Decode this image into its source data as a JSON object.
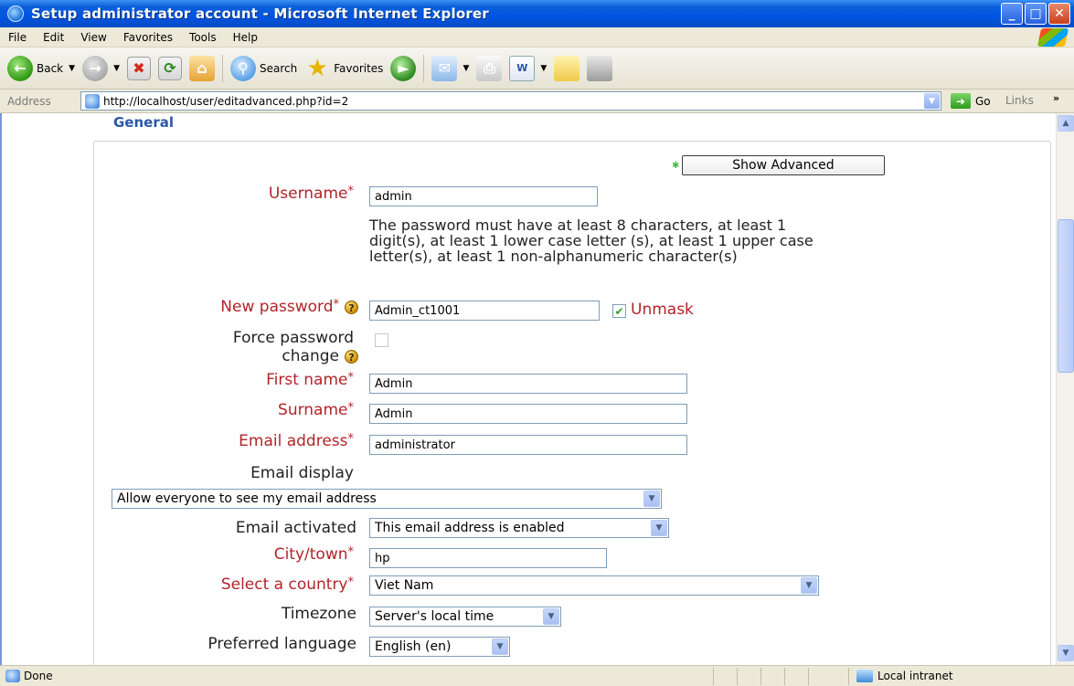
{
  "window": {
    "title": "Setup administrator account - Microsoft Internet Explorer",
    "controls": {
      "minimize": "_",
      "maximize": "□",
      "close": "✕"
    }
  },
  "menu": [
    "File",
    "Edit",
    "View",
    "Favorites",
    "Tools",
    "Help"
  ],
  "toolbar": {
    "back_label": "Back",
    "search_label": "Search",
    "favorites_label": "Favorites"
  },
  "address": {
    "label": "Address",
    "url": "http://localhost/user/editadvanced.php?id=2",
    "go_label": "Go",
    "links_label": "Links",
    "links_chevron": "»"
  },
  "form": {
    "section_title": "General",
    "show_advanced_label": "Show Advanced",
    "username": {
      "label": "Username",
      "value": "admin"
    },
    "password_policy": "The password must have at least 8 characters, at least 1 digit(s), at least 1 lower case letter (s), at least 1 upper case letter(s), at least 1 non-alphanumeric character(s)",
    "new_password": {
      "label": "New password",
      "value": "Admin_ct1001"
    },
    "unmask": {
      "label": "Unmask",
      "checked": true
    },
    "force_password_change": {
      "label_line1": "Force password",
      "label_line2": "change",
      "checked": false
    },
    "first_name": {
      "label": "First name",
      "value": "Admin"
    },
    "surname": {
      "label": "Surname",
      "value": "Admin"
    },
    "email_address": {
      "label": "Email address",
      "value": "administrator"
    },
    "email_display": {
      "label": "Email display",
      "value": "Allow everyone to see my email address"
    },
    "email_activated": {
      "label": "Email activated",
      "value": "This email address is enabled"
    },
    "city": {
      "label": "City/town",
      "value": "hp"
    },
    "country": {
      "label": "Select a country",
      "value": "Viet Nam"
    },
    "timezone": {
      "label": "Timezone",
      "value": "Server's local time"
    },
    "language": {
      "label": "Preferred language",
      "value": "English (en)"
    },
    "required_marker": "*",
    "help_marker": "?"
  },
  "status": {
    "text": "Done",
    "zone": "Local intranet"
  },
  "colors": {
    "required_label": "#b1242a",
    "section_title": "#2a57a8",
    "titlebar": "#0054e3"
  }
}
